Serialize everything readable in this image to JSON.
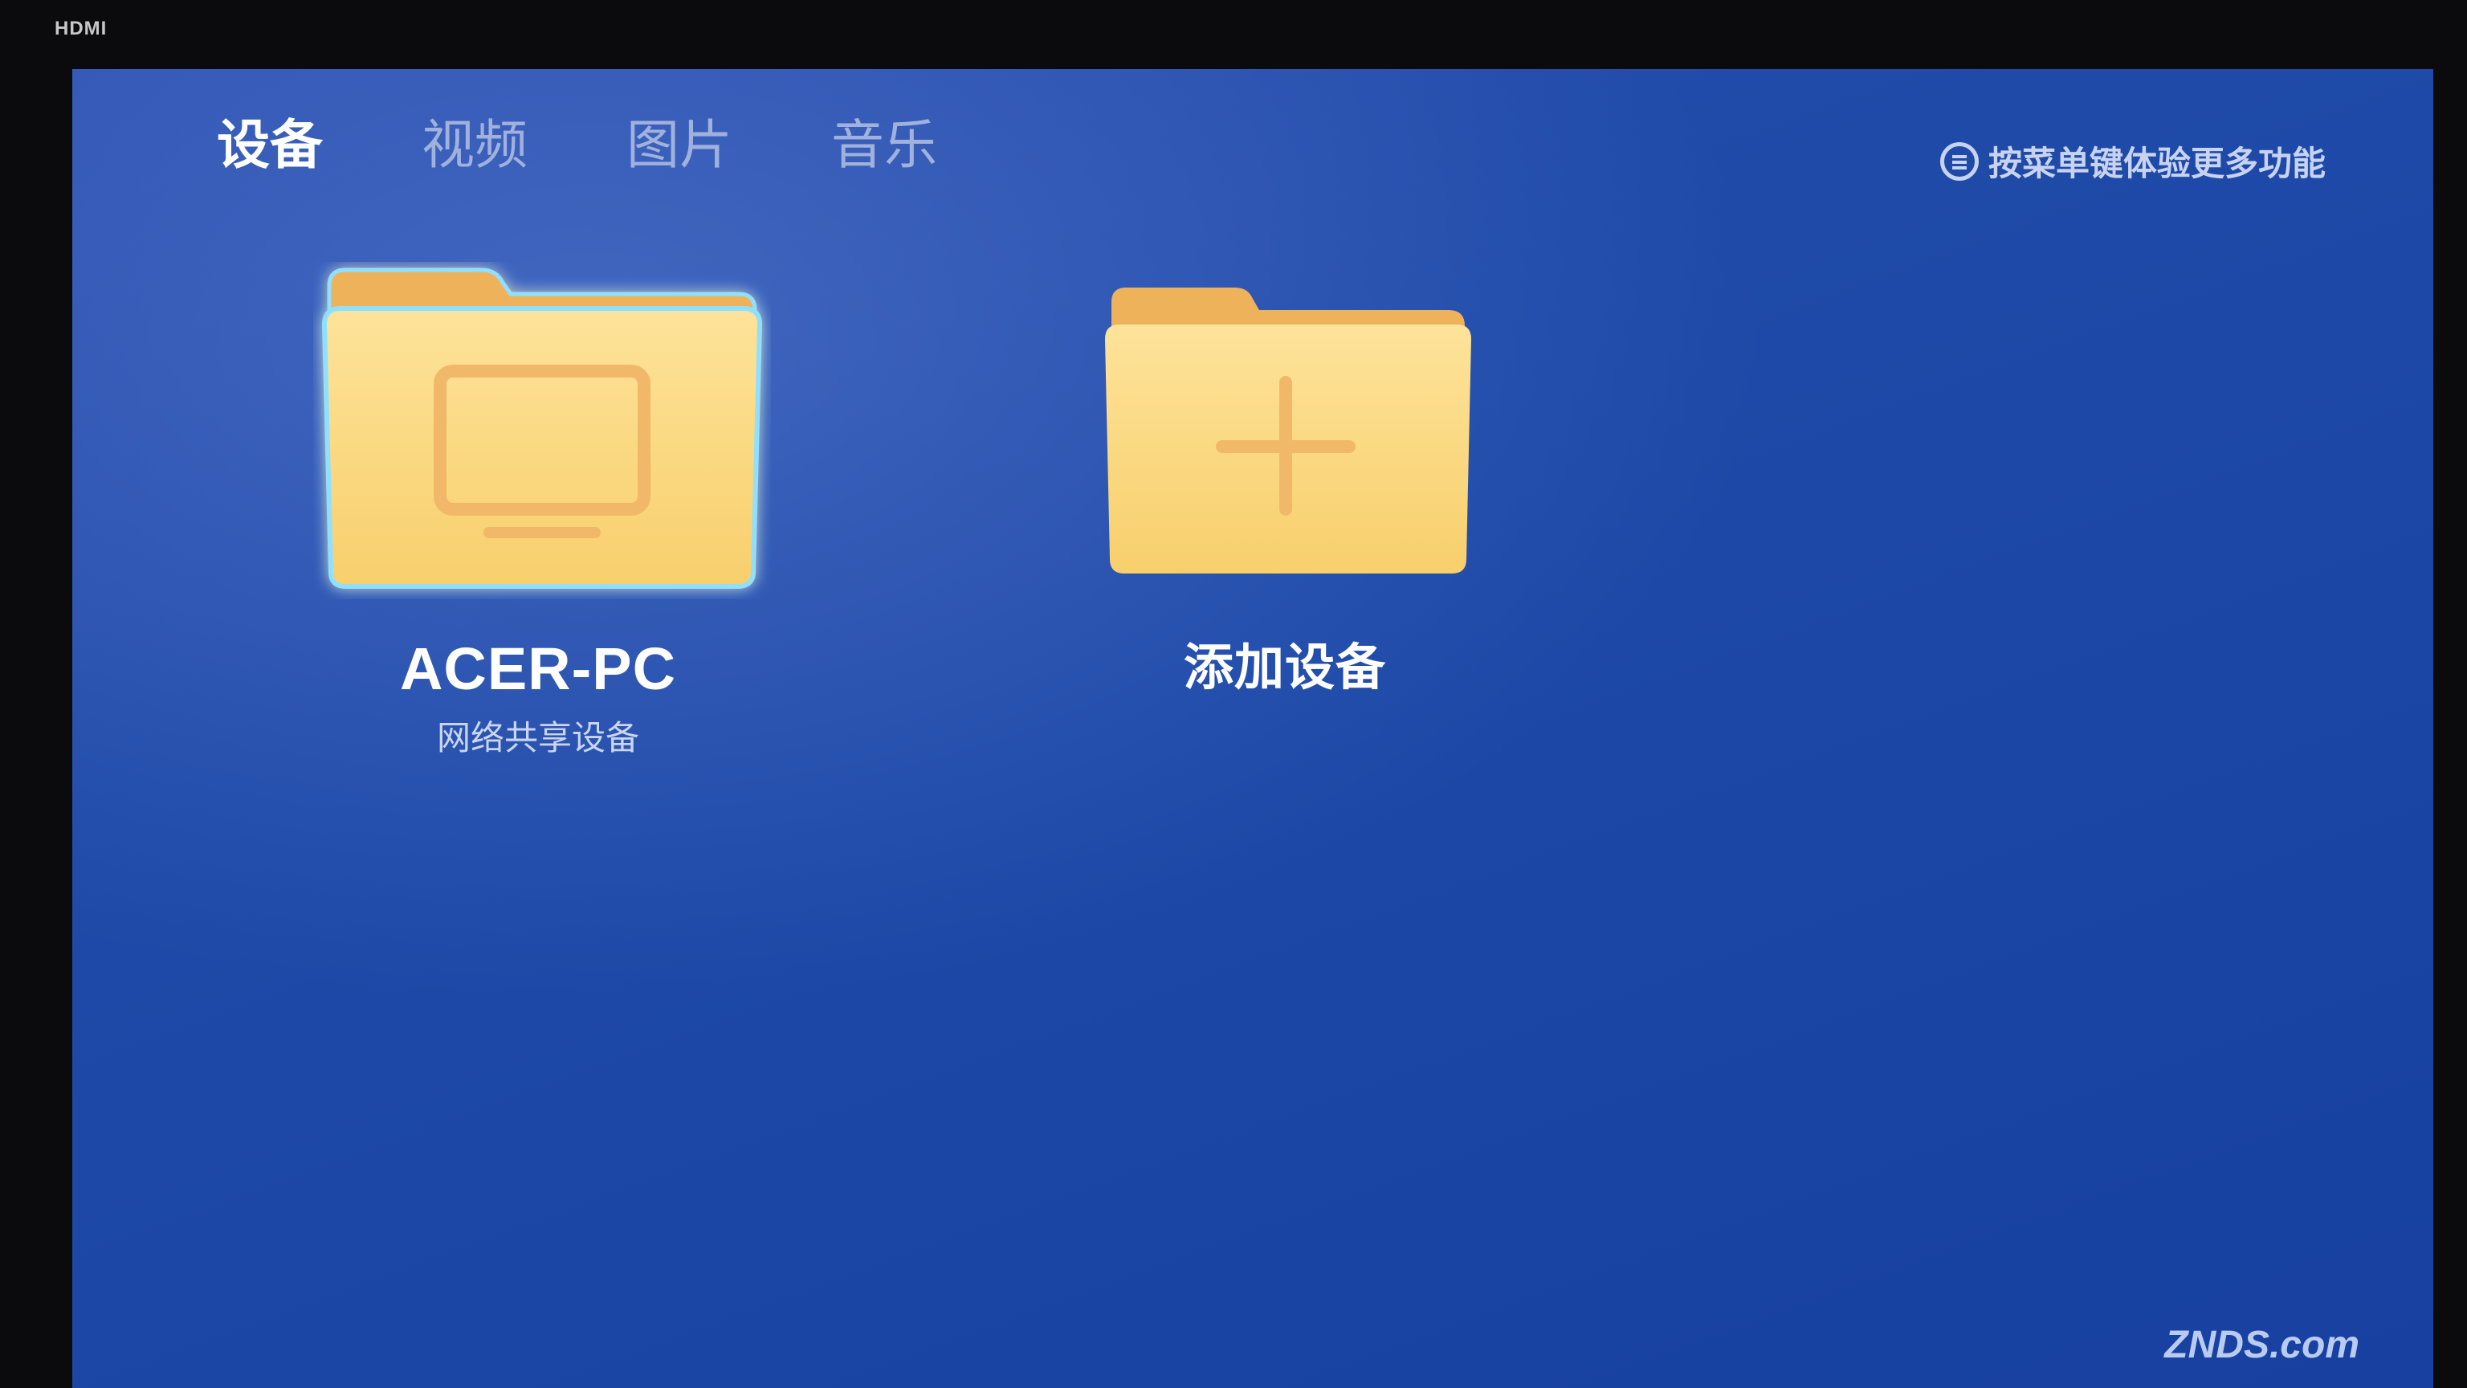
{
  "bezel": {
    "input_label": "HDMI"
  },
  "tabs": [
    {
      "label": "设备",
      "active": true
    },
    {
      "label": "视频",
      "active": false
    },
    {
      "label": "图片",
      "active": false
    },
    {
      "label": "音乐",
      "active": false
    }
  ],
  "hint": {
    "icon": "menu-icon",
    "text": "按菜单键体验更多功能"
  },
  "tiles": [
    {
      "icon": "folder-monitor-icon",
      "title": "ACER-PC",
      "subtitle": "网络共享设备",
      "focused": true
    },
    {
      "icon": "folder-add-icon",
      "title": "添加设备",
      "subtitle": ""
    }
  ],
  "colors": {
    "background": "#1f4aa8",
    "folder": "#fbd77d",
    "focus_glow": "#7ad7ff"
  },
  "watermark": "ZNDS.com"
}
